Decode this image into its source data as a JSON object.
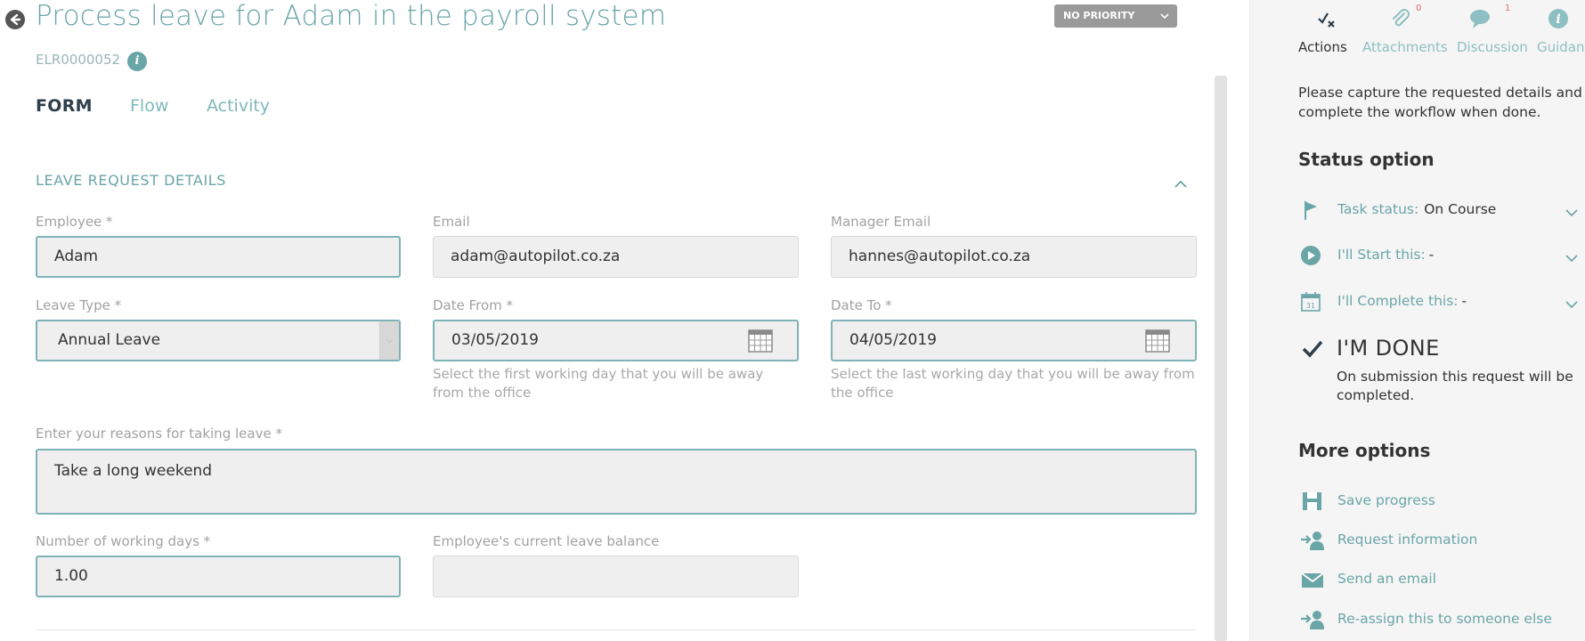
{
  "header": {
    "title": "Process leave for Adam in the payroll system",
    "reference": "ELR0000052",
    "priority_label": "NO PRIORITY"
  },
  "tabs": [
    {
      "label": "FORM",
      "active": true
    },
    {
      "label": "Flow",
      "active": false
    },
    {
      "label": "Activity",
      "active": false
    }
  ],
  "form": {
    "section_title": "LEAVE REQUEST DETAILS",
    "employee": {
      "label": "Employee *",
      "value": "Adam"
    },
    "email": {
      "label": "Email",
      "value": "adam@autopilot.co.za"
    },
    "manager_email": {
      "label": "Manager Email",
      "value": "hannes@autopilot.co.za"
    },
    "leave_type": {
      "label": "Leave Type *",
      "value": "Annual Leave"
    },
    "date_from": {
      "label": "Date From *",
      "value": "03/05/2019",
      "hint": "Select the first working day that you will be away from the office"
    },
    "date_to": {
      "label": "Date To *",
      "value": "04/05/2019",
      "hint": "Select the last working day that you will be away from the office"
    },
    "reasons": {
      "label": "Enter your reasons for taking leave *",
      "value": "Take a long weekend"
    },
    "working_days": {
      "label": "Number of working days *",
      "value": "1.00"
    },
    "leave_balance": {
      "label": "Employee's current leave balance",
      "value": ""
    }
  },
  "sidebar": {
    "tabs": [
      {
        "label": "Actions",
        "icon": "actions-icon",
        "active": true
      },
      {
        "label": "Attachments",
        "icon": "paperclip-icon",
        "count": "0"
      },
      {
        "label": "Discussion",
        "icon": "chat-bubble-icon",
        "count": "1"
      },
      {
        "label": "Guidance",
        "icon": "info-icon"
      }
    ],
    "description": "Please capture the requested details and complete the workflow when done.",
    "status_heading": "Status option",
    "task_status": {
      "label": "Task status:",
      "value": "On Course"
    },
    "start": {
      "label": "I'll Start this:",
      "value": "-"
    },
    "complete": {
      "label": "I'll Complete this:",
      "value": "-"
    },
    "done_label": "I'M DONE",
    "done_note": "On submission this request will be completed.",
    "more_heading": "More options",
    "options": [
      {
        "label": "Save progress",
        "icon": "save-icon"
      },
      {
        "label": "Request information",
        "icon": "request-info-icon"
      },
      {
        "label": "Send an email",
        "icon": "envelope-icon"
      },
      {
        "label": "Re-assign this to someone else",
        "icon": "reassign-icon"
      }
    ]
  },
  "colors": {
    "accent": "#6aa5a8",
    "field_border": "#7fb3b8",
    "priority_bg": "#9a9a9a"
  }
}
